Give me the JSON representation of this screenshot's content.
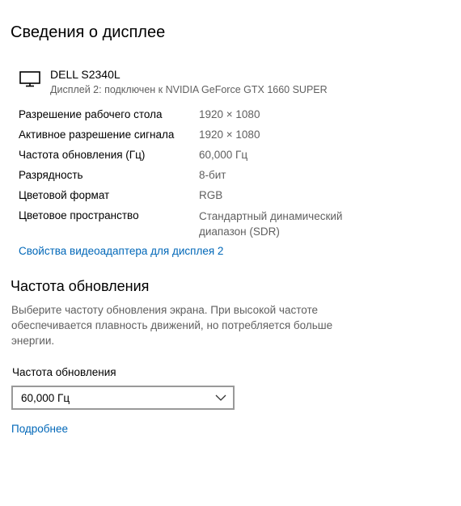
{
  "display_info": {
    "title": "Сведения о дисплее",
    "monitor": {
      "icon": "monitor-icon",
      "name": "DELL S2340L",
      "subtitle": "Дисплей 2: подключен к NVIDIA GeForce GTX 1660 SUPER"
    },
    "rows": [
      {
        "label": "Разрешение рабочего стола",
        "value": "1920 × 1080"
      },
      {
        "label": "Активное разрешение сигнала",
        "value": "1920 × 1080"
      },
      {
        "label": "Частота обновления (Гц)",
        "value": "60,000 Гц"
      },
      {
        "label": "Разрядность",
        "value": "8-бит"
      },
      {
        "label": "Цветовой формат",
        "value": "RGB"
      },
      {
        "label": "Цветовое пространство",
        "value_line1": "Стандартный динамический",
        "value_line2": "диапазон (SDR)"
      }
    ],
    "adapter_link": "Свойства видеоадаптера для дисплея 2"
  },
  "refresh_rate": {
    "title": "Частота обновления",
    "description_lines": [
      "Выберите частоту обновления экрана. При высокой частоте",
      "обеспечивается плавность движений, но потребляется больше",
      "энергии."
    ],
    "field_label": "Частота обновления",
    "selected_value": "60,000 Гц",
    "dropdown_icon": "chevron-down-icon",
    "more_link": "Подробнее"
  },
  "colors": {
    "link": "#0067b8",
    "secondary_text": "#606060",
    "select_border": "#999999"
  }
}
